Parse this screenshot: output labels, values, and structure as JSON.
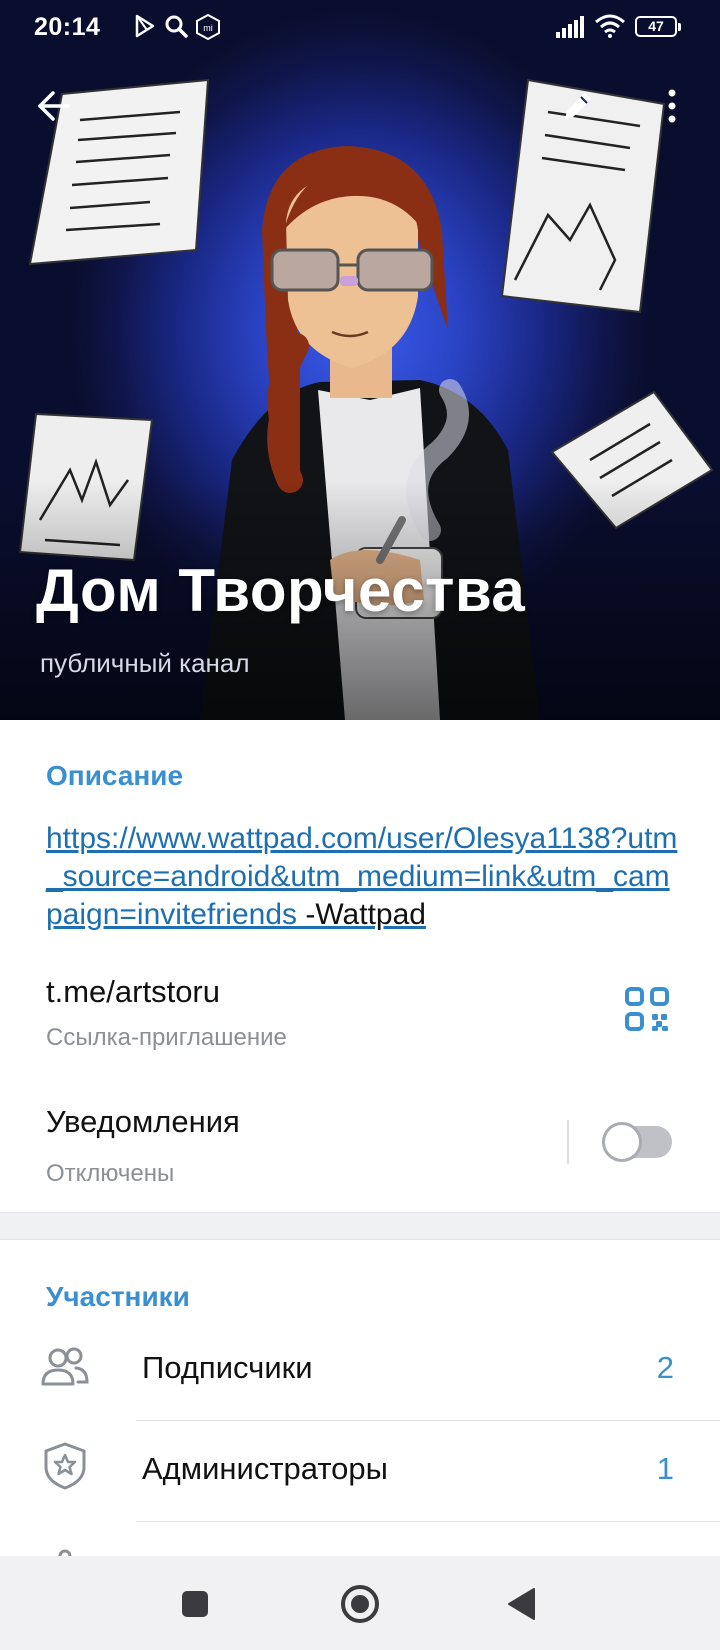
{
  "status_bar": {
    "time": "20:14",
    "battery": "47"
  },
  "header": {
    "title": "Дом Творчества",
    "subtitle": "публичный канал"
  },
  "info": {
    "description_heading": "Описание",
    "description_link": "https://www.wattpad.com/user/Olesya1138?utm_source=android&utm_medium=link&utm_campaign=invitefriends",
    "description_suffix": " -Wattpad",
    "invite_link": "t.me/artstoru",
    "invite_label": "Ссылка-приглашение",
    "notifications_label": "Уведомления",
    "notifications_state": "Отключены",
    "notifications_enabled": false
  },
  "members": {
    "heading": "Участники",
    "items": [
      {
        "label": "Подписчики",
        "count": "2",
        "icon": "people-icon"
      },
      {
        "label": "Администраторы",
        "count": "1",
        "icon": "admin-shield-icon"
      }
    ]
  },
  "colors": {
    "accent": "#3a8fd1",
    "link": "#1d6fb2",
    "cover_blue": "#2a43c4"
  }
}
